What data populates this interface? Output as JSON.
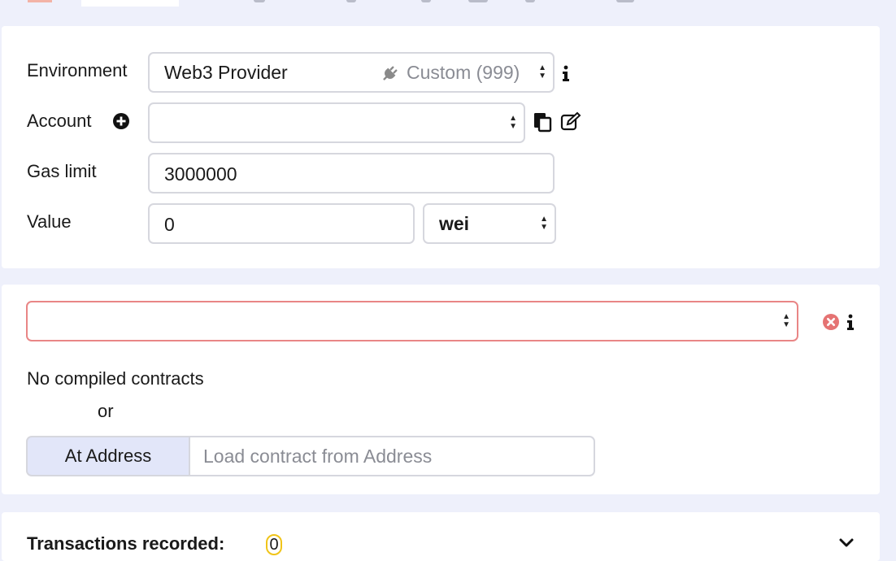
{
  "settings": {
    "environment": {
      "label": "Environment",
      "value": "Web3 Provider",
      "network": "Custom (999)"
    },
    "account": {
      "label": "Account",
      "value": ""
    },
    "gas_limit": {
      "label": "Gas limit",
      "value": "3000000"
    },
    "value": {
      "label": "Value",
      "amount": "0",
      "unit": "wei"
    }
  },
  "contracts": {
    "selected": "",
    "empty_message": "No compiled contracts",
    "or_label": "or",
    "at_address_label": "At Address",
    "address_placeholder": "Load contract from Address"
  },
  "transactions": {
    "label": "Transactions recorded:",
    "count": "0"
  },
  "colors": {
    "accent": "#e2e6f9",
    "error_border": "#e98686",
    "error_icon": "#e57373",
    "badge_border": "#f0c419",
    "background": "#eef0fb"
  }
}
